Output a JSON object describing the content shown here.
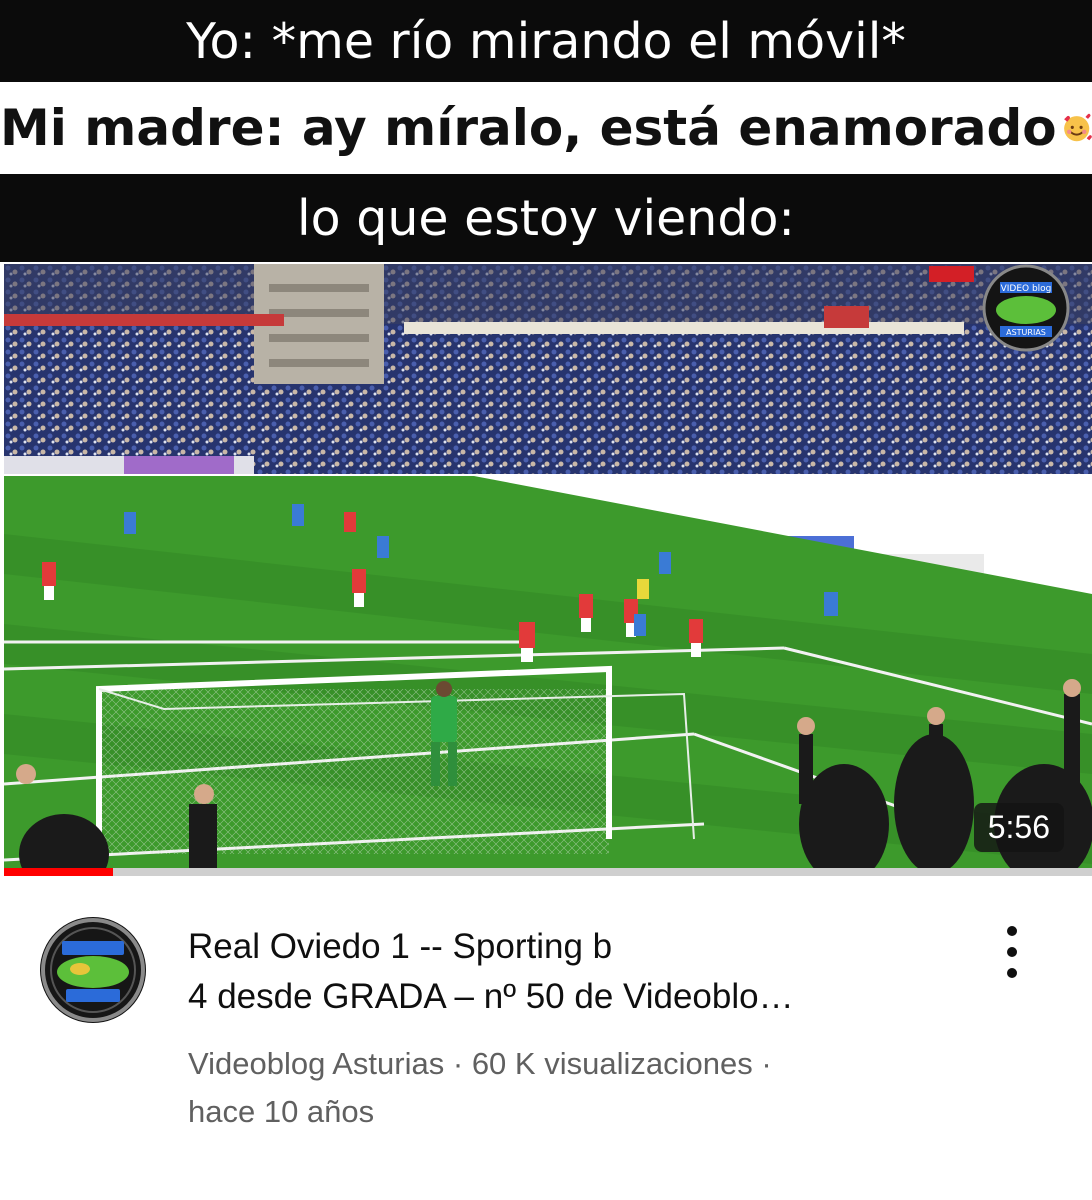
{
  "meme": {
    "caption_1": "Yo: *me río mirando el móvil*",
    "caption_2": "Mi madre: ay míralo, está enamorado",
    "caption_2_emoji": "smiling-face-with-hearts-emoji",
    "caption_3": "lo que estoy viendo:"
  },
  "video": {
    "duration": "5:56",
    "watched_fraction": 0.1,
    "watermark_text": "VIDEO blog ASTURIAS",
    "title_line_1": "Real Oviedo 1 -- Sporting b",
    "title_line_2": "4 desde GRADA – nº 50 de Videoblo…",
    "channel": "Videoblog Asturias",
    "views": "60 K visualizaciones",
    "separator": "·",
    "age": "hace 10 años",
    "more_icon": "vertical-ellipsis-icon"
  },
  "colors": {
    "progress": "#ff0000",
    "pitch_light": "#3d9a2c",
    "pitch_dark": "#2f8424",
    "crowd": "#2b3a78",
    "home_kit": "#3a7bd5",
    "away_kit": "#e23a3a",
    "keeper_kit": "#2faa47"
  }
}
